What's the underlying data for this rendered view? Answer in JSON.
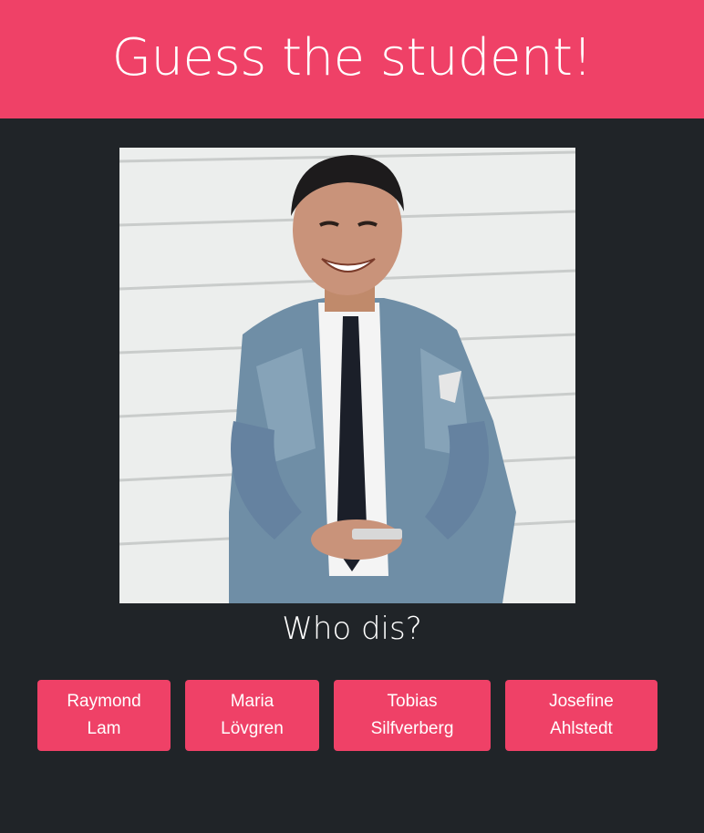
{
  "header": {
    "title": "Guess the student!"
  },
  "photo": {
    "alt": "Student photo"
  },
  "question": "Who dis?",
  "options": [
    {
      "first": "Raymond",
      "last": "Lam"
    },
    {
      "first": "Maria",
      "last": "Lövgren"
    },
    {
      "first": "Tobias",
      "last": "Silfverberg"
    },
    {
      "first": "Josefine",
      "last": "Ahlstedt"
    }
  ],
  "colors": {
    "accent": "#ef4167",
    "background": "#202428",
    "text": "#ffffff"
  }
}
